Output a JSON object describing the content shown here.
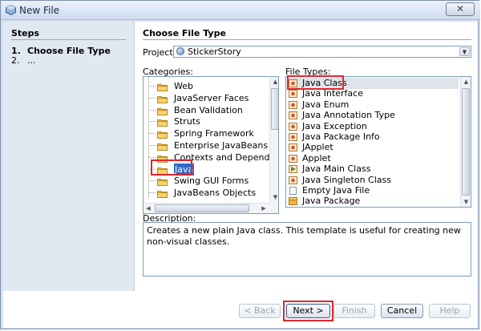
{
  "window": {
    "title": "New File",
    "close_label": "✕"
  },
  "steps": {
    "title": "Steps",
    "items": [
      {
        "num": "1.",
        "label": "Choose File Type"
      },
      {
        "num": "2.",
        "label": "..."
      }
    ]
  },
  "panel": {
    "title": "Choose File Type"
  },
  "project": {
    "label": "Project:",
    "value": "StickerStory"
  },
  "categories": {
    "label": "Categories:",
    "items": [
      "Web",
      "JavaServer Faces",
      "Bean Validation",
      "Struts",
      "Spring Framework",
      "Enterprise JavaBeans",
      "Contexts and Dependency Inje",
      "Java",
      "Swing GUI Forms",
      "JavaBeans Objects"
    ],
    "selected": "Java"
  },
  "file_types": {
    "label": "File Types:",
    "items": [
      "Java Class",
      "Java Interface",
      "Java Enum",
      "Java Annotation Type",
      "Java Exception",
      "Java Package Info",
      "JApplet",
      "Applet",
      "Java Main Class",
      "Java Singleton Class",
      "Empty Java File",
      "Java Package"
    ],
    "selected": "Java Class"
  },
  "description": {
    "label": "Description:",
    "text": "Creates a new plain Java class. This template is useful for creating new non-visual classes."
  },
  "buttons": {
    "back": "< Back",
    "next": "Next >",
    "finish": "Finish",
    "cancel": "Cancel",
    "help": "Help"
  },
  "colors": {
    "highlight": "#e0262b",
    "selection": "#3169c6",
    "folder": "#e9b740"
  }
}
